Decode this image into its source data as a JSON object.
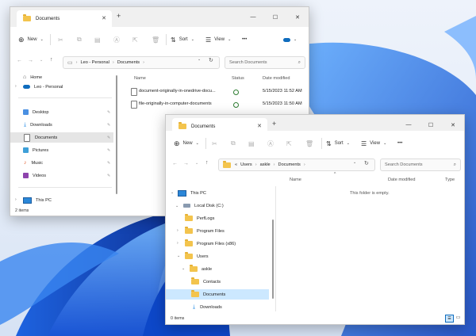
{
  "window1": {
    "tab_title": "Documents",
    "cmd": {
      "new": "New",
      "sort": "Sort",
      "view": "View",
      "more": "•••"
    },
    "breadcrumb": [
      "Leo - Personal",
      "Documents"
    ],
    "search_placeholder": "Search Documents",
    "nav": {
      "home": "Home",
      "onedrive": "Leo - Personal",
      "desktop": "Desktop",
      "downloads": "Downloads",
      "documents": "Documents",
      "pictures": "Pictures",
      "music": "Music",
      "videos": "Videos",
      "thispc": "This PC"
    },
    "columns": {
      "name": "Name",
      "status": "Status",
      "date": "Date modified"
    },
    "files": [
      {
        "name": "document-originally-in-onedrive-docu...",
        "date": "5/15/2023 11:52 AM"
      },
      {
        "name": "file-originally-in-computer-documents",
        "date": "5/15/2023 11:50 AM"
      }
    ],
    "status_bar": "2 items"
  },
  "window2": {
    "tab_title": "Documents",
    "cmd": {
      "new": "New",
      "sort": "Sort",
      "view": "View",
      "more": "•••"
    },
    "breadcrumb": [
      "«",
      "Users",
      "askle",
      "Documents"
    ],
    "search_placeholder": "Search Documents",
    "tree": {
      "thispc": "This PC",
      "localdisk": "Local Disk (C:)",
      "perflogs": "PerfLogs",
      "programfiles": "Program Files",
      "programfilesx86": "Program Files (x86)",
      "users": "Users",
      "askle": "askle",
      "contacts": "Contacts",
      "documents": "Documents",
      "downloads": "Downloads"
    },
    "columns": {
      "name": "Name",
      "date": "Date modified",
      "type": "Type"
    },
    "empty_message": "This folder is empty.",
    "status_bar": "0 items"
  },
  "colors": {
    "accent": "#0f6cbd",
    "folder": "#f3c44d",
    "selected": "#cce8ff"
  }
}
